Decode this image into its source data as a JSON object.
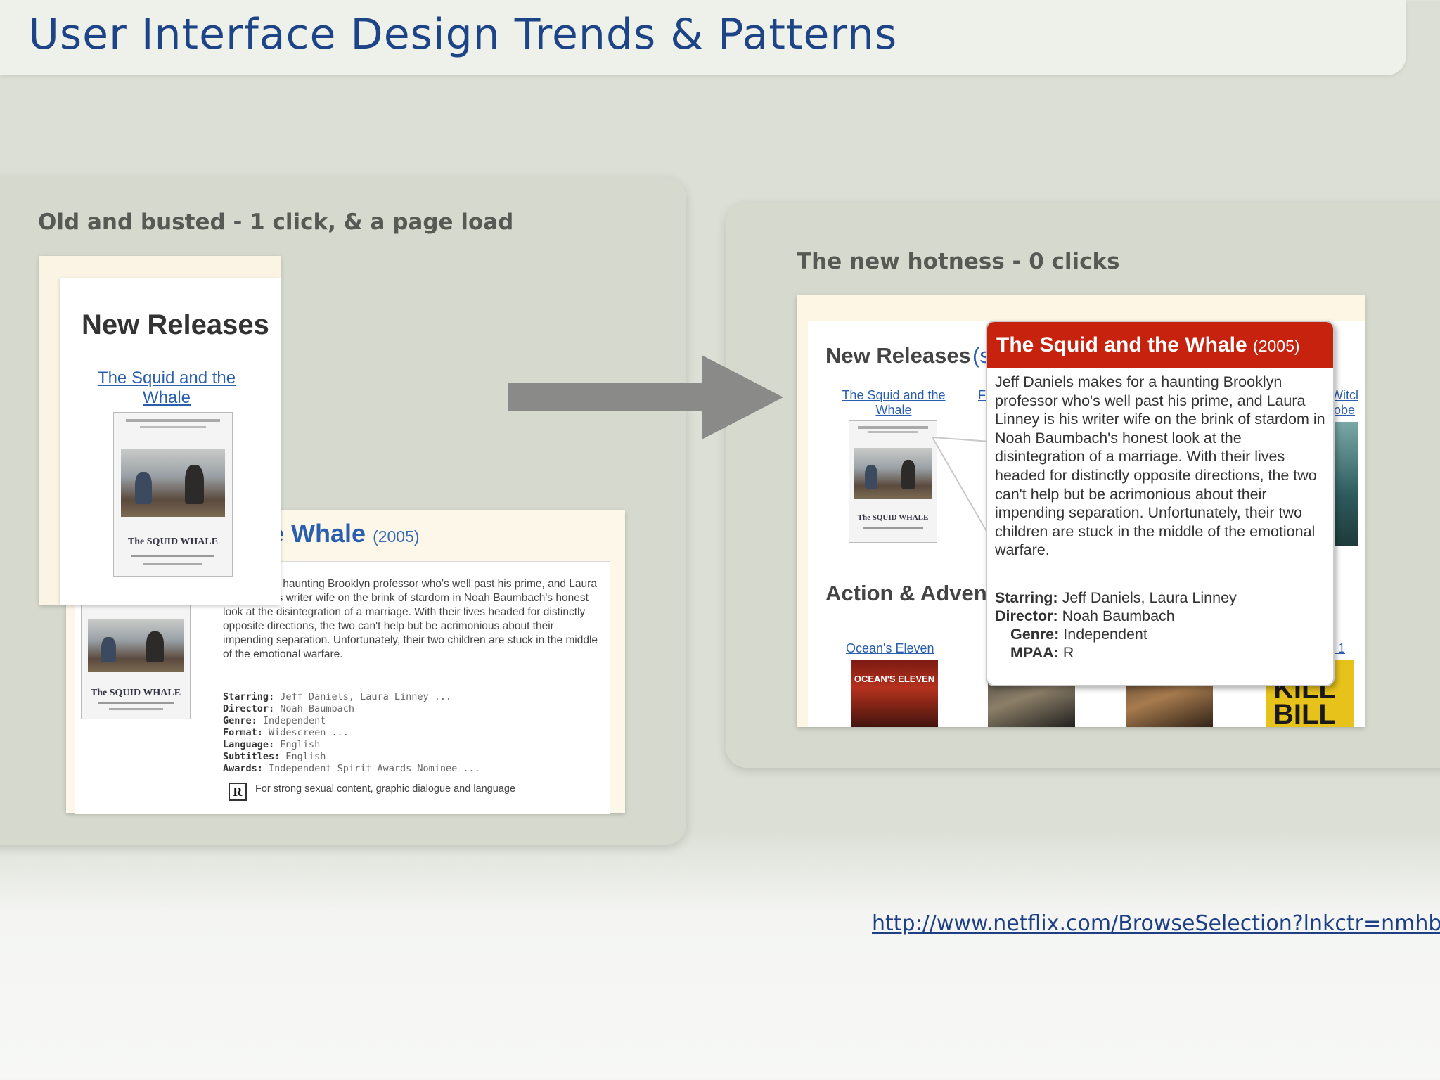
{
  "slide": {
    "title": "User Interface Design Trends & Patterns",
    "url": "http://www.netflix.com/BrowseSelection?lnkctr=nmhbs"
  },
  "left_panel": {
    "caption": "Old and busted - 1 click, & a page load",
    "new_releases": {
      "heading": "New Releases",
      "movie_link": "The Squid and the Whale",
      "poster_title": "The SQUID WHALE"
    },
    "detail": {
      "title_visible": "e Whale",
      "year": "(2005)",
      "description": "makes for a haunting Brooklyn professor who's well past his prime, and Laura Linney is his writer wife on the brink of stardom in Noah Baumbach's honest look at the disintegration of a marriage. With their lives headed for distinctly opposite directions, the two can't help but be acrimonious about their impending separation. Unfortunately, their two children are stuck in the middle of the emotional warfare.",
      "starring_label": "Starring:",
      "starring": "Jeff Daniels, Laura Linney ...",
      "director_label": "Director:",
      "director": "Noah Baumbach",
      "genre_label": "Genre:",
      "genre": "Independent",
      "format_label": "Format:",
      "format": "Widescreen ...",
      "language_label": "Language:",
      "language": "English",
      "subtitles_label": "Subtitles:",
      "subtitles": "English",
      "awards_label": "Awards:",
      "awards": "Independent Spirit Awards Nominee ...",
      "rating": "R",
      "rating_reason": "For strong sexual content, graphic dialogue and language"
    }
  },
  "right_panel": {
    "caption": "The new hotness - 0 clicks",
    "new_releases_heading": "New Releases",
    "new_releases_more": "(s",
    "movie_link": "The Squid and the Whale",
    "partial_link_f": "F",
    "partial_link_witch_1": "Witcl",
    "partial_link_witch_2": "robe",
    "action_heading": "Action & Adven",
    "oceans_link": "Ocean's Eleven",
    "oceans_poster_text": "OCEAN'S ELEVEN",
    "partial_link_kb": ". 1",
    "kb_poster_text": "KILL BILL",
    "popup": {
      "title": "The Squid and the Whale",
      "year": "(2005)",
      "description": "Jeff Daniels makes for a haunting Brooklyn professor who's well past his prime, and Laura Linney is his writer wife on the brink of stardom in Noah Baumbach's honest look at the disintegration of a marriage. With their lives headed for distinctly opposite directions, the two can't help but be acrimonious about their impending separation. Unfortunately, their two children are stuck in the middle of the emotional warfare.",
      "starring_label": "Starring:",
      "starring": "Jeff Daniels, Laura Linney",
      "director_label": "Director:",
      "director": "Noah Baumbach",
      "genre_label": "Genre:",
      "genre": "Independent",
      "mpaa_label": "MPAA:",
      "mpaa": "R"
    }
  },
  "colors": {
    "title_blue": "#1d4487",
    "panel": "#d6d9cd",
    "popup_header_red": "#c7220d",
    "link_blue": "#2a5fae",
    "arrow_gray": "#8a8a88"
  },
  "icons": [
    "right-arrow-icon",
    "mpaa-r-rating-icon",
    "popup-pointer-icon"
  ]
}
